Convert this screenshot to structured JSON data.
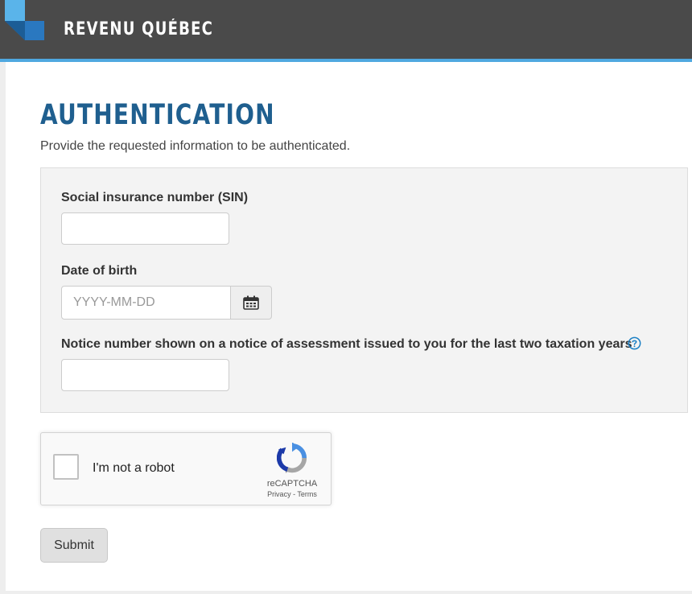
{
  "header": {
    "brand": "REVENU QUÉBEC",
    "colors": {
      "bar": "#4a4a4a",
      "accent": "#4fa8e0",
      "logo_light": "#5ab4ea",
      "logo_dark": "#2a78c0"
    }
  },
  "page": {
    "title": "AUTHENTICATION",
    "title_color": "#1f5f8f",
    "intro": "Provide the requested information to be authenticated."
  },
  "form": {
    "sin": {
      "label": "Social insurance number (SIN)",
      "value": "",
      "placeholder": ""
    },
    "dob": {
      "label": "Date of birth",
      "value": "",
      "placeholder": "YYYY-MM-DD",
      "button_icon": "calendar-icon"
    },
    "notice": {
      "label": "Notice number shown on a notice of assessment issued to you for the last two taxation years",
      "value": "",
      "placeholder": "",
      "help_icon": "question-circle-icon"
    }
  },
  "recaptcha": {
    "label": "I'm not a robot",
    "checked": false,
    "brand": "reCAPTCHA",
    "privacy": "Privacy",
    "separator": " - ",
    "terms": "Terms"
  },
  "actions": {
    "submit_label": "Submit"
  }
}
